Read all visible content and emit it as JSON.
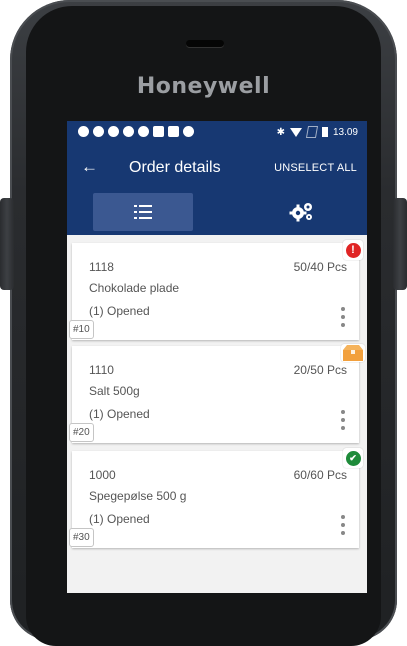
{
  "device": {
    "brand": "Honeywell"
  },
  "statusbar": {
    "time": "13.09",
    "bluetooth": "✱"
  },
  "appbar": {
    "back_icon": "←",
    "title": "Order details",
    "action": "UNSELECT ALL"
  },
  "colors": {
    "primary": "#173872",
    "tab_active": "#3b5891",
    "error": "#e02424",
    "warning": "#f2a03d",
    "ok": "#1e8b3a"
  },
  "tabs": [
    {
      "icon": "list-icon",
      "active": true
    },
    {
      "icon": "gears-icon",
      "active": false
    }
  ],
  "items": [
    {
      "id": "1118",
      "name": "Chokolade plade",
      "status": "(1) Opened",
      "qty": "50/40 Pcs",
      "pos": "#10",
      "flag": "error-icon",
      "flag_text": "!"
    },
    {
      "id": "1110",
      "name": "Salt 500g",
      "status": "(1) Opened",
      "qty": "20/50 Pcs",
      "pos": "#20",
      "flag": "box-icon",
      "flag_text": ""
    },
    {
      "id": "1000",
      "name": "Spegepølse 500 g",
      "status": "(1) Opened",
      "qty": "60/60 Pcs",
      "pos": "#30",
      "flag": "check-icon",
      "flag_text": "✔"
    }
  ]
}
